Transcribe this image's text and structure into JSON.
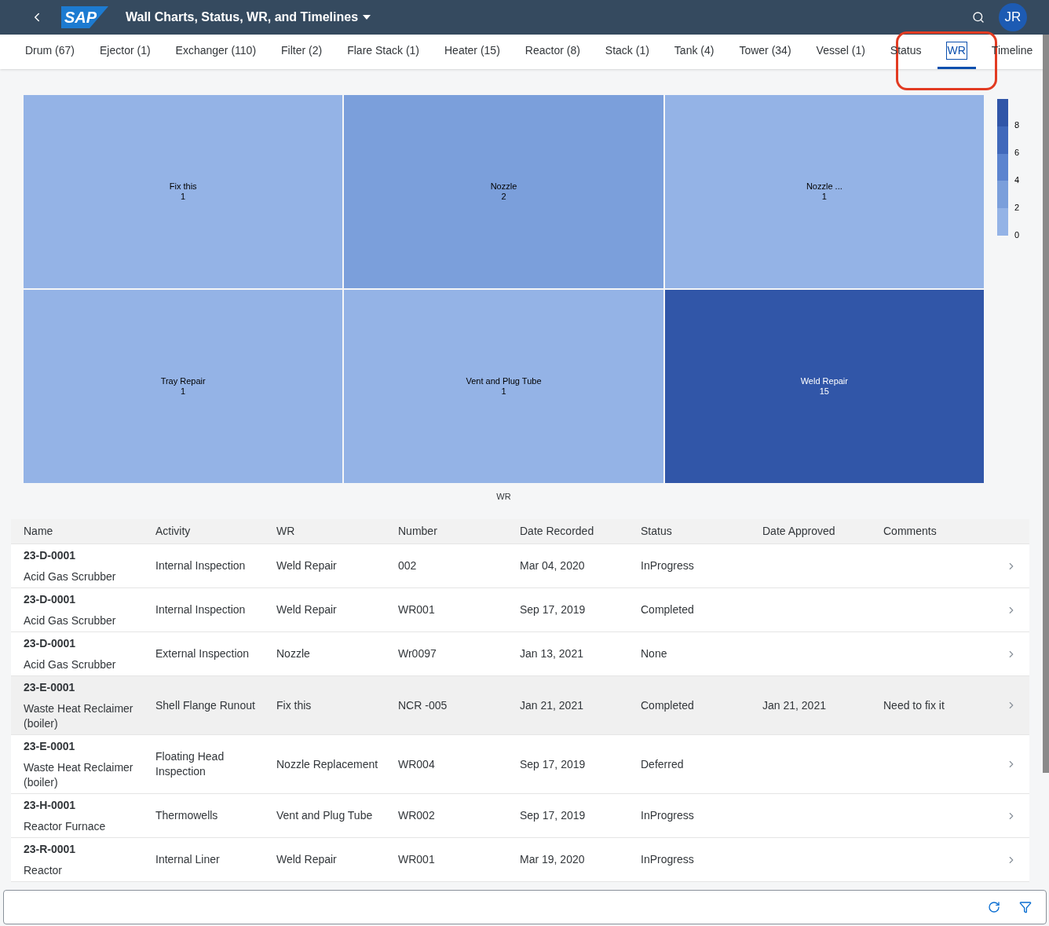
{
  "header": {
    "logo": "SAP",
    "title": "Wall Charts, Status, WR, and Timelines",
    "avatar": "JR"
  },
  "tabs": [
    {
      "label": "Drum (67)",
      "selected": false
    },
    {
      "label": "Ejector (1)",
      "selected": false
    },
    {
      "label": "Exchanger (110)",
      "selected": false
    },
    {
      "label": "Filter (2)",
      "selected": false
    },
    {
      "label": "Flare Stack (1)",
      "selected": false
    },
    {
      "label": "Heater (15)",
      "selected": false
    },
    {
      "label": "Reactor (8)",
      "selected": false
    },
    {
      "label": "Stack (1)",
      "selected": false
    },
    {
      "label": "Tank (4)",
      "selected": false
    },
    {
      "label": "Tower (34)",
      "selected": false
    },
    {
      "label": "Vessel (1)",
      "selected": false
    },
    {
      "label": "Status",
      "selected": false
    },
    {
      "label": "WR",
      "selected": true
    },
    {
      "label": "Timeline",
      "selected": false
    }
  ],
  "treemap": {
    "tiles": [
      {
        "label": "Fix this",
        "value": "1",
        "color": "#94b3e6"
      },
      {
        "label": "Nozzle",
        "value": "2",
        "color": "#7b9fdb"
      },
      {
        "label": "Nozzle ...",
        "value": "1",
        "color": "#94b3e6"
      },
      {
        "label": "Tray Repair",
        "value": "1",
        "color": "#94b3e6"
      },
      {
        "label": "Vent and Plug Tube",
        "value": "1",
        "color": "#94b3e6"
      },
      {
        "label": "Weld Repair",
        "value": "15",
        "color": "#3156a8"
      }
    ],
    "legend": {
      "ticks": [
        "8",
        "6",
        "4",
        "2",
        "0"
      ]
    },
    "caption": "WR"
  },
  "table": {
    "columns": [
      "Name",
      "Activity",
      "WR",
      "Number",
      "Date Recorded",
      "Status",
      "Date Approved",
      "Comments"
    ],
    "rows": [
      {
        "name": "23-D-0001",
        "description": "Acid Gas Scrubber",
        "activity": "Internal Inspection",
        "wr": "Weld Repair",
        "number": "002",
        "date_recorded": "Mar 04, 2020",
        "status": "InProgress",
        "date_approved": "",
        "comments": "",
        "selected": false
      },
      {
        "name": "23-D-0001",
        "description": "Acid Gas Scrubber",
        "activity": "Internal Inspection",
        "wr": "Weld Repair",
        "number": "WR001",
        "date_recorded": "Sep 17, 2019",
        "status": "Completed",
        "date_approved": "",
        "comments": "",
        "selected": false
      },
      {
        "name": "23-D-0001",
        "description": "Acid Gas Scrubber",
        "activity": "External Inspection",
        "wr": "Nozzle",
        "number": "Wr0097",
        "date_recorded": "Jan 13, 2021",
        "status": "None",
        "date_approved": "",
        "comments": "",
        "selected": false
      },
      {
        "name": "23-E-0001",
        "description": "Waste Heat Reclaimer (boiler)",
        "activity": "Shell Flange Runout",
        "wr": "Fix this",
        "number": "NCR -005",
        "date_recorded": "Jan 21, 2021",
        "status": "Completed",
        "date_approved": "Jan 21, 2021",
        "comments": "Need to fix it",
        "selected": true
      },
      {
        "name": "23-E-0001",
        "description": "Waste Heat Reclaimer (boiler)",
        "activity": "Floating Head Inspection",
        "wr": "Nozzle Replacement",
        "number": "WR004",
        "date_recorded": "Sep 17, 2019",
        "status": "Deferred",
        "date_approved": "",
        "comments": "",
        "selected": false
      },
      {
        "name": "23-H-0001",
        "description": "Reactor Furnace",
        "activity": "Thermowells",
        "wr": "Vent and Plug Tube",
        "number": "WR002",
        "date_recorded": "Sep 17, 2019",
        "status": "InProgress",
        "date_approved": "",
        "comments": "",
        "selected": false
      },
      {
        "name": "23-R-0001",
        "description": "Reactor",
        "activity": "Internal Liner",
        "wr": "Weld Repair",
        "number": "WR001",
        "date_recorded": "Mar 19, 2020",
        "status": "InProgress",
        "date_approved": "",
        "comments": "",
        "selected": false
      }
    ]
  }
}
